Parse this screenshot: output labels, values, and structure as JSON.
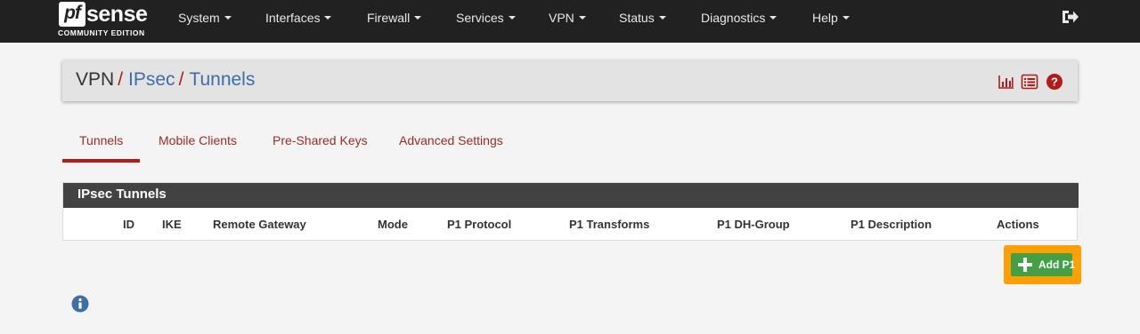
{
  "brand": {
    "logo_mark": "pf",
    "logo_word": "sense",
    "edition": "COMMUNITY EDITION"
  },
  "nav": {
    "items": [
      {
        "label": "System"
      },
      {
        "label": "Interfaces"
      },
      {
        "label": "Firewall"
      },
      {
        "label": "Services"
      },
      {
        "label": "VPN"
      },
      {
        "label": "Status"
      },
      {
        "label": "Diagnostics"
      },
      {
        "label": "Help"
      }
    ],
    "logout_icon": "sign-out-icon"
  },
  "breadcrumb": {
    "root": "VPN",
    "separator": "/",
    "level1": "IPsec",
    "level2": "Tunnels",
    "icons": [
      "bar-chart-icon",
      "list-icon",
      "help-icon"
    ]
  },
  "tabs": [
    {
      "label": "Tunnels",
      "active": true
    },
    {
      "label": "Mobile Clients",
      "active": false
    },
    {
      "label": "Pre-Shared Keys",
      "active": false
    },
    {
      "label": "Advanced Settings",
      "active": false
    }
  ],
  "panel": {
    "title": "IPsec Tunnels",
    "columns": [
      "ID",
      "IKE",
      "Remote Gateway",
      "Mode",
      "P1 Protocol",
      "P1 Transforms",
      "P1 DH-Group",
      "P1 Description",
      "Actions"
    ],
    "rows": []
  },
  "actions": {
    "add_p1_label": "Add P1"
  },
  "info_icon": "info-circle-icon",
  "colors": {
    "accent_red": "#b31b1b",
    "link_blue": "#3d6fa6",
    "button_green": "#43a047",
    "highlight_orange": "#ff9f00",
    "navbar": "#212121"
  }
}
